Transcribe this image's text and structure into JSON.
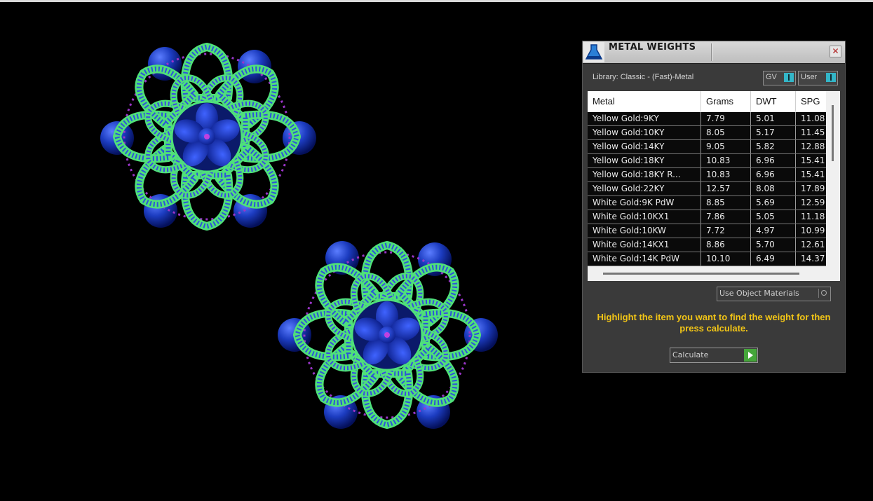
{
  "panel": {
    "title": "METAL WEIGHTS",
    "close_icon": "close-icon",
    "library_label": "Library: Classic - (Fast)-Metal",
    "dropdown_gv": "GV",
    "dropdown_user": "User",
    "columns": [
      "Metal",
      "Grams",
      "DWT",
      "SPG"
    ],
    "rows": [
      {
        "metal": "Yellow Gold:9KY",
        "grams": "7.79",
        "dwt": "5.01",
        "spg": "11.08"
      },
      {
        "metal": "Yellow Gold:10KY",
        "grams": "8.05",
        "dwt": "5.17",
        "spg": "11.45"
      },
      {
        "metal": "Yellow Gold:14KY",
        "grams": "9.05",
        "dwt": "5.82",
        "spg": "12.88"
      },
      {
        "metal": "Yellow Gold:18KY",
        "grams": "10.83",
        "dwt": "6.96",
        "spg": "15.41"
      },
      {
        "metal": "Yellow Gold:18KY R...",
        "grams": "10.83",
        "dwt": "6.96",
        "spg": "15.41"
      },
      {
        "metal": "Yellow Gold:22KY",
        "grams": "12.57",
        "dwt": "8.08",
        "spg": "17.89"
      },
      {
        "metal": "White Gold:9K PdW",
        "grams": "8.85",
        "dwt": "5.69",
        "spg": "12.59"
      },
      {
        "metal": "White Gold:10KX1",
        "grams": "7.86",
        "dwt": "5.05",
        "spg": "11.18"
      },
      {
        "metal": "White Gold:10KW",
        "grams": "7.72",
        "dwt": "4.97",
        "spg": "10.99"
      },
      {
        "metal": "White Gold:14KX1",
        "grams": "8.86",
        "dwt": "5.70",
        "spg": "12.61"
      },
      {
        "metal": "White Gold:14K PdW",
        "grams": "10.10",
        "dwt": "6.49",
        "spg": "14.37"
      }
    ],
    "materials_select": "Use Object Materials",
    "hint": "Highlight the item you want to find the weight for then press calculate.",
    "calculate_label": "Calculate"
  },
  "colors": {
    "hint": "#f2c516",
    "gem": "#1a3fd0",
    "metal_green": "#4fe07a",
    "accent_purple": "#9a35c8",
    "dropdown_button": "#33b6c8",
    "calc_button": "#45a63a"
  }
}
